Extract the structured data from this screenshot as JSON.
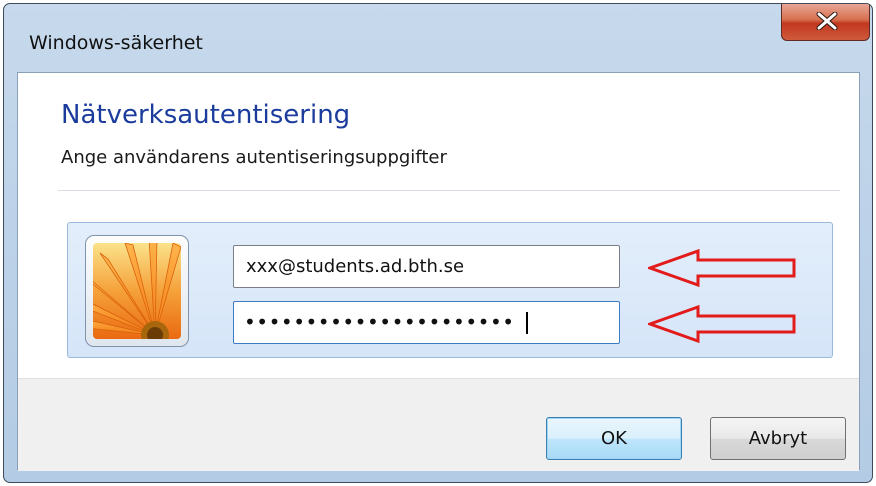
{
  "window": {
    "title": "Windows-säkerhet",
    "close_glyph": "X"
  },
  "dialog": {
    "heading": "Nätverksautentisering",
    "subheading": "Ange användarens autentiseringsuppgifter"
  },
  "credentials": {
    "avatar_icon": "user-tile-flower-icon",
    "username_value": "xxx@students.ad.bth.se",
    "password_value": "••••••••••••••••••••••"
  },
  "annotations": {
    "arrow_color": "#e21b1b",
    "arrow_icon": "red-left-arrow-icon"
  },
  "buttons": {
    "ok_label": "OK",
    "cancel_label": "Avbryt"
  },
  "colors": {
    "heading_blue": "#1b3c9c",
    "close_red": "#c2381f",
    "panel_blue": "#d5e5f8"
  }
}
